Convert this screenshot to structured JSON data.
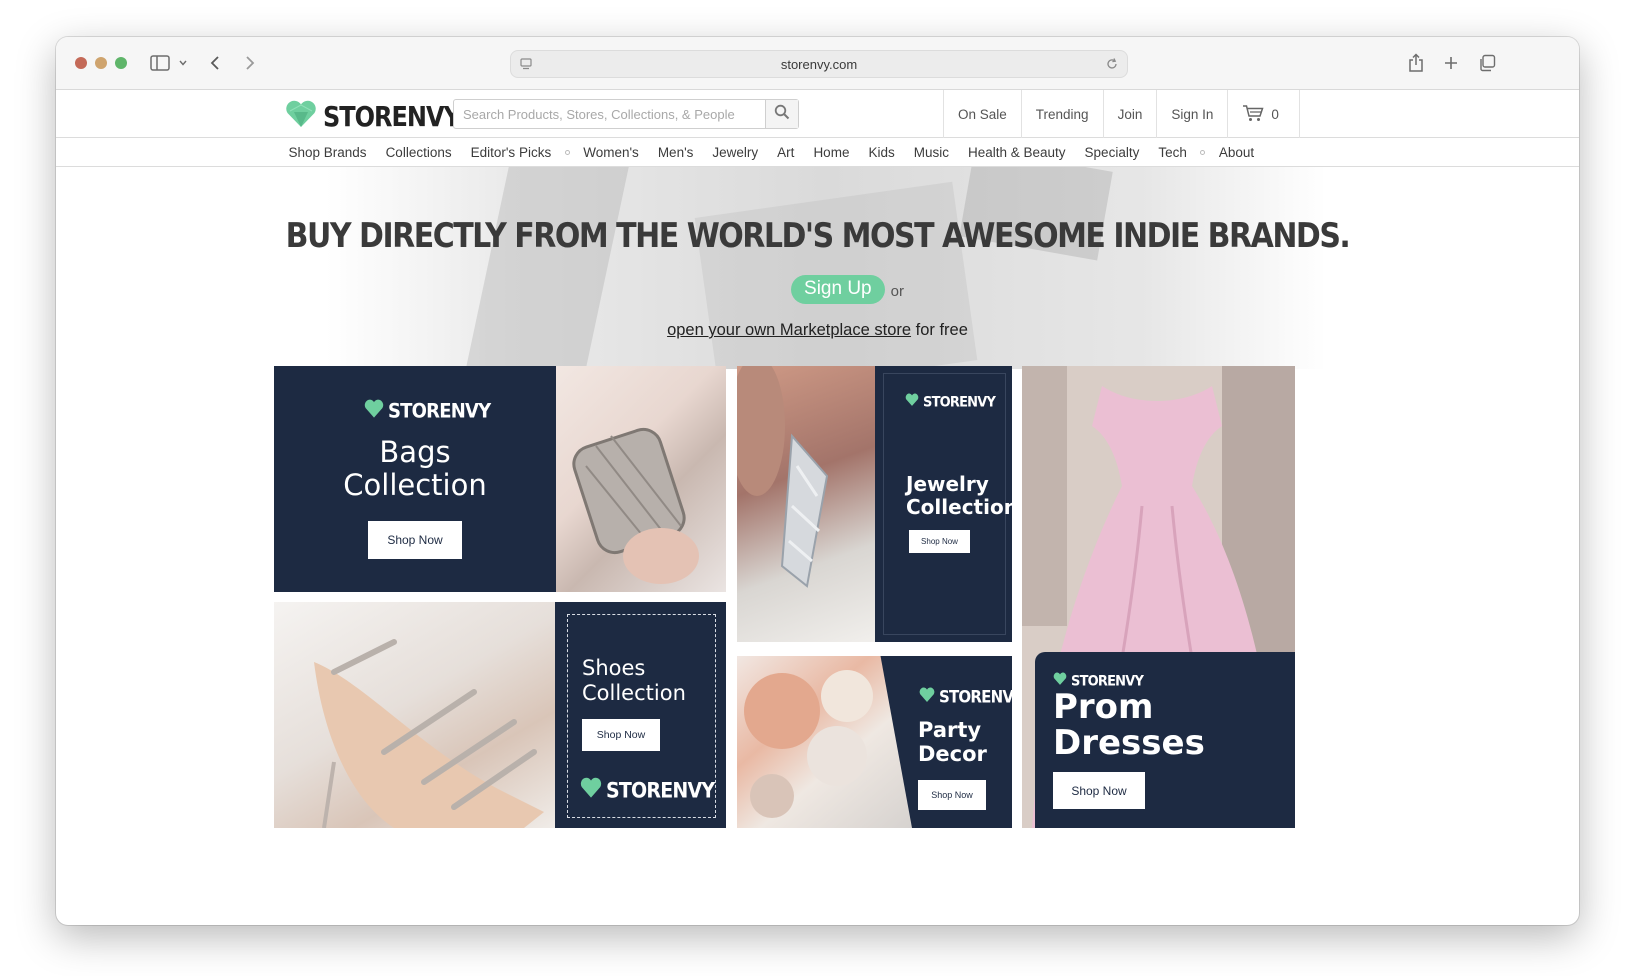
{
  "browser": {
    "url": "storenvy.com"
  },
  "header": {
    "logo_text": "STORENVY",
    "search_placeholder": "Search Products, Stores, Collections, & People",
    "links": {
      "on_sale": "On Sale",
      "trending": "Trending",
      "join": "Join",
      "sign_in": "Sign In",
      "cart_count": "0"
    }
  },
  "nav": {
    "shop_brands": "Shop Brands",
    "collections": "Collections",
    "editors_picks": "Editor's Picks",
    "womens": "Women's",
    "mens": "Men's",
    "jewelry": "Jewelry",
    "art": "Art",
    "home": "Home",
    "kids": "Kids",
    "music": "Music",
    "health_beauty": "Health & Beauty",
    "specialty": "Specialty",
    "tech": "Tech",
    "about": "About"
  },
  "hero": {
    "title": "BUY DIRECTLY FROM THE WORLD'S MOST AWESOME INDIE BRANDS.",
    "signup_label": "Sign Up",
    "or_text": "or",
    "open_store_link": "open your own Marketplace store",
    "open_store_suffix": " for free"
  },
  "promos": {
    "bags": {
      "brand": "STORENVY",
      "title_line1": "Bags",
      "title_line2": "Collection",
      "cta": "Shop Now"
    },
    "shoes": {
      "brand": "STORENVY",
      "title_line1": "Shoes",
      "title_line2": "Collection",
      "cta": "Shop Now"
    },
    "jewelry": {
      "brand": "STORENVY",
      "title_line1": "Jewelry",
      "title_line2": "Collection",
      "cta": "Shop Now"
    },
    "party": {
      "brand": "STORENVY",
      "title_line1": "Party",
      "title_line2": "Decor",
      "cta": "Shop Now"
    },
    "prom": {
      "brand": "STORENVY",
      "title_line1": "Prom",
      "title_line2": "Dresses",
      "cta": "Shop Now"
    }
  },
  "colors": {
    "brand_green": "#6fcf9f",
    "navy": "#1d2a42"
  },
  "icons": {
    "sidebar": "sidebar-icon",
    "back": "chevron-left-icon",
    "forward": "chevron-right-icon",
    "share": "share-icon",
    "new_tab": "plus-icon",
    "tabs": "tabs-overview-icon",
    "search": "magnifier-icon",
    "cart": "cart-icon",
    "logo": "heart-tag-icon"
  }
}
